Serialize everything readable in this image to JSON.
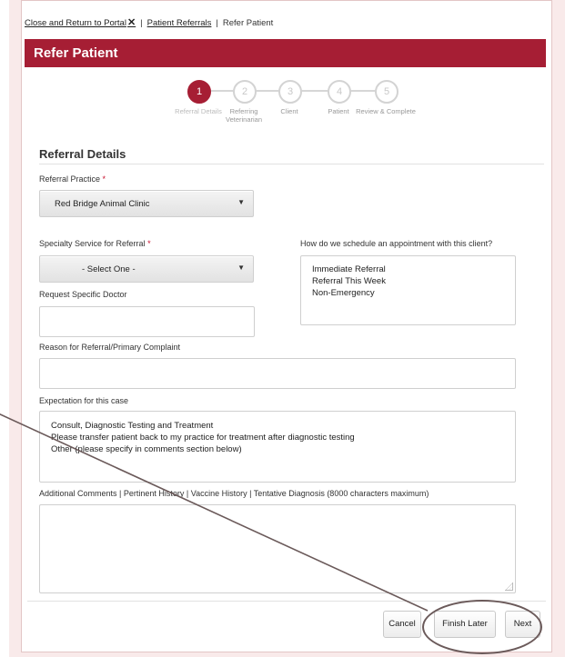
{
  "breadcrumb": {
    "close_link": "Close and Return to Portal",
    "close_icon": "✕",
    "separator": "|",
    "referrals_link": "Patient Referrals",
    "current": "Refer Patient"
  },
  "header": {
    "title": "Refer Patient"
  },
  "stepper": {
    "steps": [
      {
        "number": "1",
        "label": "Referral Details",
        "active": true
      },
      {
        "number": "2",
        "label": "Referring Veterinarian",
        "active": false
      },
      {
        "number": "3",
        "label": "Client",
        "active": false
      },
      {
        "number": "4",
        "label": "Patient",
        "active": false
      },
      {
        "number": "5",
        "label": "Review & Complete",
        "active": false
      }
    ]
  },
  "section": {
    "title": "Referral Details"
  },
  "form": {
    "referral_practice": {
      "label": "Referral Practice",
      "required_mark": "*",
      "value": "Red Bridge Animal Clinic"
    },
    "specialty_service": {
      "label": "Specialty Service for Referral",
      "required_mark": "*",
      "value": "- Select One -"
    },
    "request_doctor": {
      "label": "Request Specific Doctor",
      "value": ""
    },
    "schedule": {
      "label": "How do we schedule an appointment with this client?",
      "options": [
        "Immediate Referral",
        "Referral This Week",
        "Non-Emergency"
      ]
    },
    "reason": {
      "label": "Reason for Referral/Primary Complaint",
      "value": ""
    },
    "expectation": {
      "label": "Expectation for this case",
      "options": [
        "Consult, Diagnostic Testing and Treatment",
        "Please transfer patient back to my practice for treatment after diagnostic testing",
        "Other (please specify in comments section below)"
      ]
    },
    "comments": {
      "label": "Additional Comments | Pertinent History | Vaccine History | Tentative Diagnosis (8000 characters maximum)",
      "value": ""
    }
  },
  "footer": {
    "cancel_label": "Cancel",
    "finish_later_label": "Finish Later",
    "next_label": "Next"
  },
  "colors": {
    "brand": "#a61e34",
    "required": "#c8102e",
    "annotation": "#6b5a5a"
  },
  "icons": {
    "select_caret": "caret-down-icon",
    "close": "close-icon"
  }
}
